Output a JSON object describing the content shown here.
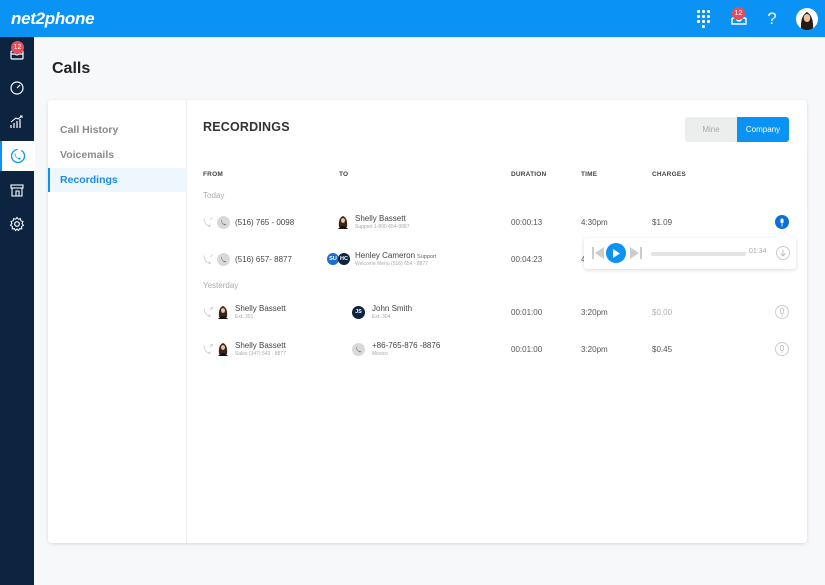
{
  "app": {
    "logo": "net2phone",
    "header": {
      "inbox_badge": "12",
      "help_label": "?"
    },
    "sidebar": {
      "inbox_badge": "12",
      "items": [
        {
          "icon": "inbox-icon",
          "active": false
        },
        {
          "icon": "dashboard-gauge-icon",
          "active": false
        },
        {
          "icon": "analytics-icon",
          "active": false
        },
        {
          "icon": "phone-icon",
          "active": true
        },
        {
          "icon": "store-icon",
          "active": false
        },
        {
          "icon": "settings-icon",
          "active": false
        }
      ]
    }
  },
  "page": {
    "title": "Calls"
  },
  "subnav": {
    "items": [
      {
        "label": "Call History",
        "active": false
      },
      {
        "label": "Voicemails",
        "active": false
      },
      {
        "label": "Recordings",
        "active": true
      }
    ]
  },
  "recordings": {
    "title": "RECORDINGS",
    "toggle": {
      "mine": "Mine",
      "company": "Company",
      "selected": "Company"
    },
    "columns": {
      "from": "FROM",
      "to": "TO",
      "duration": "DURATION",
      "time": "TIME",
      "charges": "CHARGES"
    },
    "groups": [
      {
        "label": "Today",
        "rows": [
          {
            "from": {
              "name": "(516) 765 - 0098",
              "sub": ""
            },
            "to": {
              "name": "Shelly Bassett",
              "tag": "",
              "sub": "Support 1-800-654-9987"
            },
            "duration": "00:00:13",
            "time": "4:30pm",
            "charges": "$1.09",
            "recording_active": true
          },
          {
            "from": {
              "name": "(516) 657- 8877",
              "sub": ""
            },
            "to": {
              "name": "Henley Cameron",
              "tag": "Support",
              "sub": "Welcome Menu (516) 654 - 8877",
              "avatars": [
                "SU",
                "HC"
              ]
            },
            "duration": "00:04:23",
            "time": "4:30pm",
            "charges": "",
            "recording_active": false
          }
        ]
      },
      {
        "label": "Yesterday",
        "rows": [
          {
            "from": {
              "name": "Shelly Bassett",
              "sub": "Ext. 301"
            },
            "to": {
              "name": "John Smith",
              "tag": "",
              "sub": "Ext. 304",
              "avatars": [
                "JS"
              ]
            },
            "duration": "00:01:00",
            "time": "3:20pm",
            "charges": "$0.00",
            "recording_active": false
          },
          {
            "from": {
              "name": "Shelly Bassett",
              "sub": "Sales (347) 543 - 8877"
            },
            "to": {
              "name": "+86-765-876 -8876",
              "tag": "",
              "sub": "Mexico"
            },
            "duration": "00:01:00",
            "time": "3:20pm",
            "charges": "$0.45",
            "recording_active": false
          }
        ]
      }
    ],
    "player": {
      "elapsed": "01:34",
      "progress": 0
    }
  },
  "colors": {
    "brand": "#0a93f5",
    "sidebar": "#0c2440",
    "badge": "#e84c5b",
    "mic_active": "#0a6fd6"
  }
}
